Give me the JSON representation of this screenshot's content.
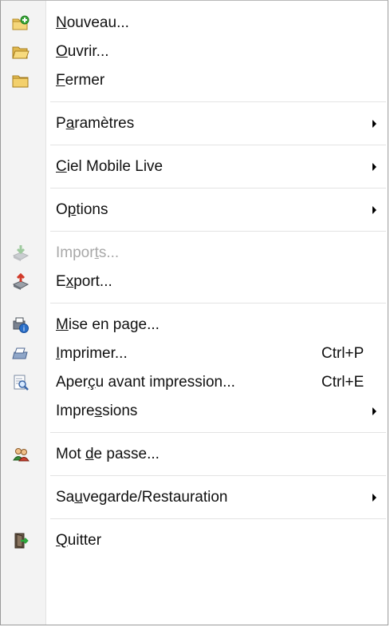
{
  "menu": {
    "items": [
      {
        "pre": "",
        "mn": "N",
        "post": "ouveau...",
        "icon": "new-folder-icon"
      },
      {
        "pre": "",
        "mn": "O",
        "post": "uvrir...",
        "icon": "open-folder-icon"
      },
      {
        "pre": "",
        "mn": "F",
        "post": "ermer",
        "icon": "close-folder-icon"
      },
      {
        "pre": "P",
        "mn": "a",
        "post": "ramètres"
      },
      {
        "pre": "",
        "mn": "C",
        "post": "iel Mobile Live"
      },
      {
        "pre": "O",
        "mn": "p",
        "post": "tions"
      },
      {
        "pre": "Impor",
        "mn": "t",
        "post": "s...",
        "icon": "import-icon"
      },
      {
        "pre": "E",
        "mn": "x",
        "post": "port...",
        "icon": "export-icon"
      },
      {
        "pre": "",
        "mn": "M",
        "post": "ise en page...",
        "icon": "page-setup-icon"
      },
      {
        "pre": "",
        "mn": "I",
        "post": "mprimer...",
        "icon": "printer-icon",
        "shortcut": "Ctrl+P"
      },
      {
        "pre": "Aper",
        "mn": "ç",
        "post": "u avant impression...",
        "icon": "print-preview-icon",
        "shortcut": "Ctrl+E"
      },
      {
        "pre": "Impre",
        "mn": "s",
        "post": "sions"
      },
      {
        "pre": "Mot ",
        "mn": "d",
        "post": "e passe...",
        "icon": "users-icon"
      },
      {
        "pre": "Sa",
        "mn": "u",
        "post": "vegarde/Restauration"
      },
      {
        "pre": "",
        "mn": "Q",
        "post": "uitter",
        "icon": "exit-door-icon"
      }
    ]
  }
}
